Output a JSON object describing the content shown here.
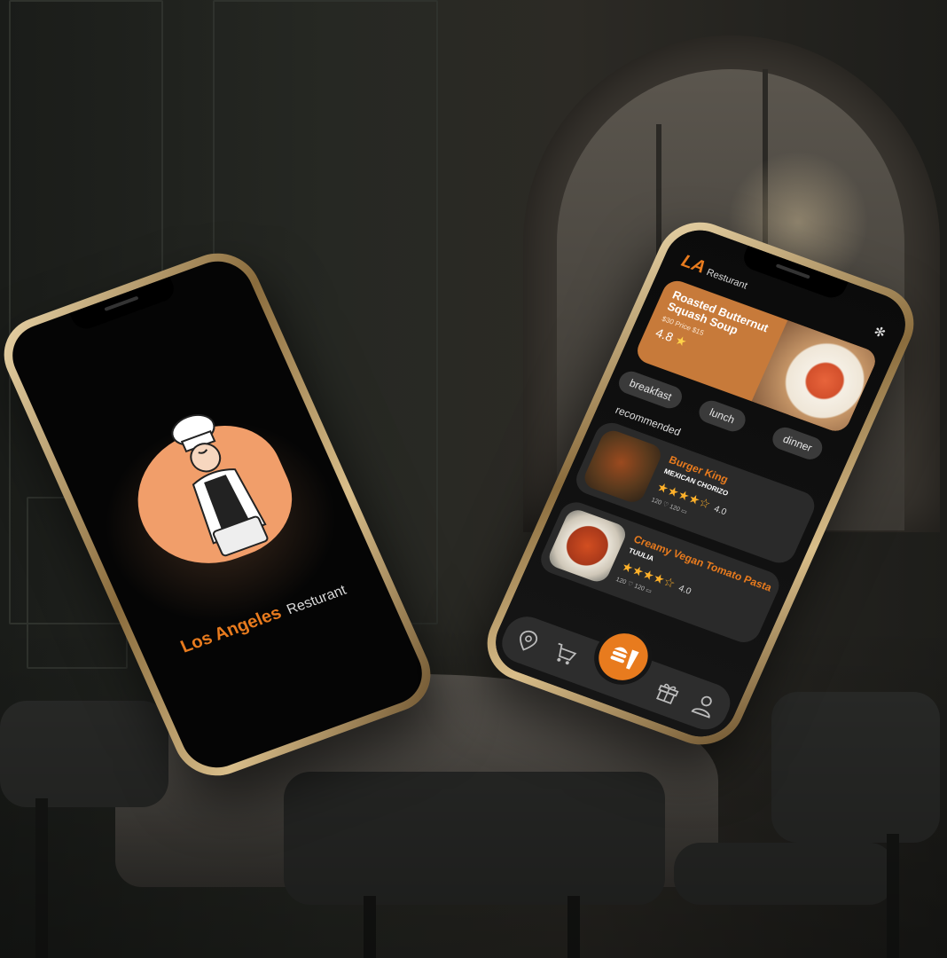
{
  "splash": {
    "title_primary": "Los Angeles",
    "title_secondary": "Resturant"
  },
  "app": {
    "brand_short": "LA",
    "brand_name": "Resturant",
    "featured": {
      "name": "Roasted Butternut Squash Soup",
      "price_line": "$30  Price  $15",
      "rating": "4.8"
    },
    "categories": [
      "breakfast",
      "lunch",
      "dinner"
    ],
    "section_label": "recommended",
    "items": [
      {
        "title": "Burger King",
        "subtitle": "MEXICAN CHORIZO",
        "stars": "★★★★☆",
        "rating": "4.0",
        "likes": "120",
        "comments": "120"
      },
      {
        "title": "Creamy Vegan Tomato Pasta",
        "subtitle": "TUULIA",
        "stars": "★★★★☆",
        "rating": "4.0",
        "likes": "120",
        "comments": "120"
      }
    ]
  },
  "colors": {
    "accent": "#e87b1e",
    "card": "#2a2a2a",
    "featured": "#c77a3a"
  },
  "icons": {
    "nav": [
      "location-icon",
      "cart-icon",
      "food-icon",
      "gift-icon",
      "profile-icon"
    ]
  }
}
